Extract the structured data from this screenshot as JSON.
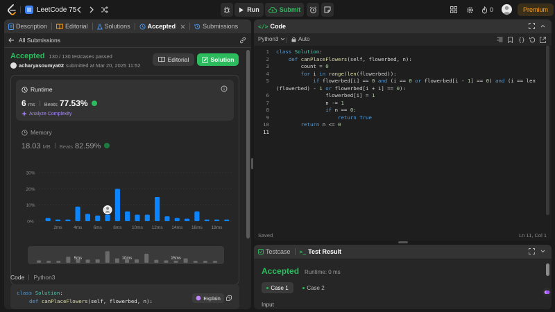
{
  "topbar": {
    "problem_list_label": "LeetCode 75",
    "run_label": "Run",
    "submit_label": "Submit",
    "streak_count": "0",
    "premium_label": "Premium"
  },
  "left_tabs": [
    {
      "label": "Description"
    },
    {
      "label": "Editorial"
    },
    {
      "label": "Solutions"
    },
    {
      "label": "Accepted"
    },
    {
      "label": "Submissions"
    }
  ],
  "submission": {
    "back_label": "All Submissions",
    "status": "Accepted",
    "testcases": "130 / 130 testcases passed",
    "user": "acharyasoumya02",
    "submitted_text": "submitted at Mar 20, 2025 11:52",
    "editorial_label": "Editorial",
    "solution_label": "Solution"
  },
  "runtime": {
    "title": "Runtime",
    "value": "6",
    "unit": "ms",
    "beats_label": "Beats",
    "beats_value": "77.53%",
    "analyze_label": "Analyze Complexity"
  },
  "memory": {
    "title": "Memory",
    "value": "18.03",
    "unit": "MB",
    "beats_label": "Beats",
    "beats_value": "82.59%"
  },
  "chart_data": {
    "type": "bar",
    "y_ticks": [
      "30%",
      "20%",
      "10%",
      "0%"
    ],
    "ylim": [
      0,
      30
    ],
    "x_ticks": [
      "2ms",
      "4ms",
      "6ms",
      "8ms",
      "10ms",
      "12ms",
      "14ms",
      "16ms",
      "18ms"
    ],
    "bars": [
      {
        "x": 0,
        "value": 2.0
      },
      {
        "x": 1,
        "value": 1.0
      },
      {
        "x": 2,
        "value": 1.0
      },
      {
        "x": 3,
        "value": 9.0
      },
      {
        "x": 4,
        "value": 4.5
      },
      {
        "x": 5,
        "value": 3.5
      },
      {
        "x": 6,
        "value": 4.0,
        "mine": true
      },
      {
        "x": 7,
        "value": 20.0
      },
      {
        "x": 8,
        "value": 6.0
      },
      {
        "x": 9,
        "value": 4.0
      },
      {
        "x": 10,
        "value": 4.0
      },
      {
        "x": 11,
        "value": 15.0
      },
      {
        "x": 12,
        "value": 3.0
      },
      {
        "x": 13,
        "value": 2.0
      },
      {
        "x": 14,
        "value": 1.5
      },
      {
        "x": 15,
        "value": 6.0
      },
      {
        "x": 16,
        "value": 1.0
      },
      {
        "x": 17,
        "value": 1.0
      },
      {
        "x": 18,
        "value": 1.0
      }
    ],
    "minimap_ticks": [
      "5ms",
      "10ms",
      "15ms"
    ]
  },
  "code_section": {
    "title": "Code",
    "lang": "Python3",
    "line1_class": "class",
    "line1_name": "Solution",
    "line2_def": "def",
    "line2_fn": "canPlaceFlowers",
    "line2_args": "(self, flowerbed, n):",
    "explain_label": "Explain"
  },
  "editor": {
    "title": "Code",
    "language": "Python3",
    "mode": "Auto",
    "saved": "Saved",
    "cursor": "Ln 11, Col 1"
  },
  "bottom": {
    "testcase_tab": "Testcase",
    "result_tab": "Test Result",
    "status": "Accepted",
    "runtime": "Runtime: 0 ms",
    "case1": "Case 1",
    "case2": "Case 2",
    "input_label": "Input"
  },
  "colors": {
    "accent_green": "#2cbb5d",
    "bar_blue": "#0a84ff",
    "premium_orange": "#ffa116"
  }
}
